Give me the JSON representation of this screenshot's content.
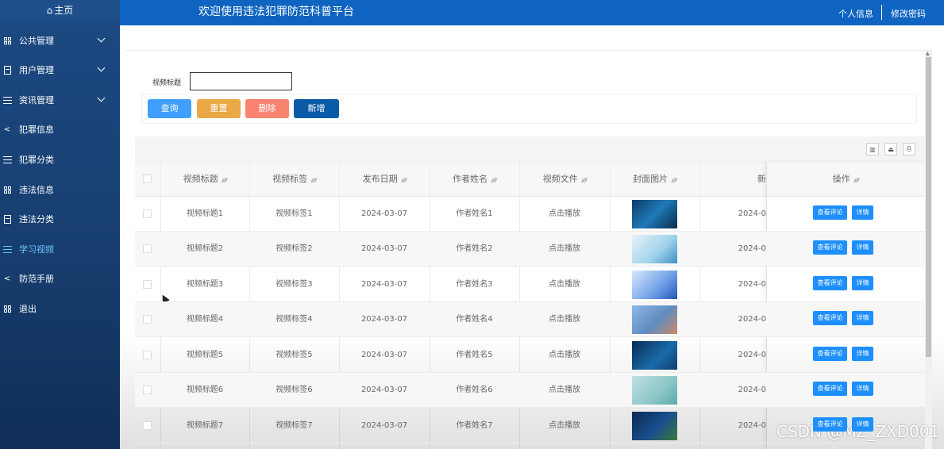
{
  "sidebar": {
    "home": "主页",
    "items": [
      {
        "label": "公共管理",
        "icon": "grid-icon",
        "has_arrow": true
      },
      {
        "label": "用户管理",
        "icon": "doc-icon",
        "has_arrow": true
      },
      {
        "label": "资讯管理",
        "icon": "list-icon",
        "has_arrow": true
      },
      {
        "label": "犯罪信息",
        "icon": "share-icon",
        "has_arrow": false
      },
      {
        "label": "犯罪分类",
        "icon": "list-icon",
        "has_arrow": false
      },
      {
        "label": "违法信息",
        "icon": "grid-icon",
        "has_arrow": false
      },
      {
        "label": "违法分类",
        "icon": "doc-icon",
        "has_arrow": false
      },
      {
        "label": "学习视频",
        "icon": "list-icon",
        "has_arrow": false,
        "active": true
      },
      {
        "label": "防范手册",
        "icon": "share-icon",
        "has_arrow": false
      },
      {
        "label": "退出",
        "icon": "grid-icon",
        "has_arrow": false
      }
    ]
  },
  "header": {
    "title": "欢迎使用违法犯罪防范科普平台",
    "user_info": "个人信息",
    "change_password": "修改密码"
  },
  "search": {
    "label": "视频标题",
    "value": "",
    "buttons": {
      "query": "查询",
      "reset": "重置",
      "delete": "删除",
      "add": "新增"
    },
    "colors": {
      "query": "#409eff",
      "reset": "#eba847",
      "delete": "#f88371",
      "add": "#0a5aa8"
    }
  },
  "table": {
    "columns": [
      "视频标题",
      "视频标签",
      "发布日期",
      "作者姓名",
      "视频文件",
      "封面图片",
      "新",
      "操作"
    ],
    "actions": {
      "comments": "查看评论",
      "detail": "详情"
    },
    "rows": [
      {
        "title": "视频标题1",
        "tag": "视频标签1",
        "date": "2024-03-07",
        "author": "作者姓名1",
        "file": "点击播放",
        "extra": "2024-0"
      },
      {
        "title": "视频标题2",
        "tag": "视频标签2",
        "date": "2024-03-07",
        "author": "作者姓名2",
        "file": "点击播放",
        "extra": "2024-0"
      },
      {
        "title": "视频标题3",
        "tag": "视频标签3",
        "date": "2024-03-07",
        "author": "作者姓名3",
        "file": "点击播放",
        "extra": "2024-0"
      },
      {
        "title": "视频标题4",
        "tag": "视频标签4",
        "date": "2024-03-07",
        "author": "作者姓名4",
        "file": "点击播放",
        "extra": "2024-0"
      },
      {
        "title": "视频标题5",
        "tag": "视频标签5",
        "date": "2024-03-07",
        "author": "作者姓名5",
        "file": "点击播放",
        "extra": "2024-0"
      },
      {
        "title": "视频标题6",
        "tag": "视频标签6",
        "date": "2024-03-07",
        "author": "作者姓名6",
        "file": "点击播放",
        "extra": "2024-0"
      },
      {
        "title": "视频标题7",
        "tag": "视频标签7",
        "date": "2024-03-07",
        "author": "作者姓名7",
        "file": "点击播放",
        "extra": "2024-0"
      }
    ]
  },
  "watermark": "CSDN @MZ_ZXD001"
}
